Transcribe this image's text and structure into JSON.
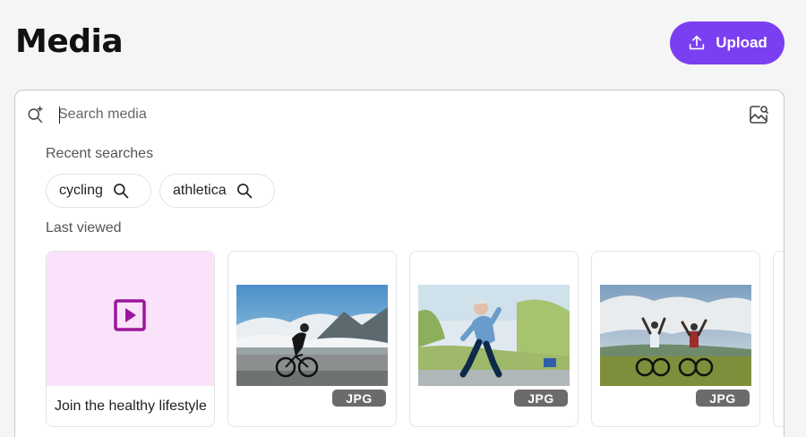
{
  "header": {
    "title": "Media",
    "upload_label": "Upload",
    "upload_icon": "upload-icon",
    "accent": "#7b3ff2"
  },
  "search": {
    "placeholder": "Search media",
    "value": "",
    "left_icon": "ai-search-icon",
    "right_icon": "image-search-icon"
  },
  "recent": {
    "label": "Recent searches",
    "chips": [
      {
        "label": "cycling",
        "icon": "search-icon"
      },
      {
        "label": "athletica",
        "icon": "search-icon"
      }
    ]
  },
  "last_viewed": {
    "label": "Last viewed",
    "items": [
      {
        "type": "video",
        "title": "Join the healthy lifestyle",
        "icon": "video-icon",
        "thumb_color": "#fbe2fb"
      },
      {
        "type": "image",
        "badge": "JPG",
        "subject": "cyclist on mountain road"
      },
      {
        "type": "image",
        "badge": "JPG",
        "subject": "woman running in park"
      },
      {
        "type": "image",
        "badge": "JPG",
        "subject": "two mountain bikers celebrating"
      }
    ]
  }
}
